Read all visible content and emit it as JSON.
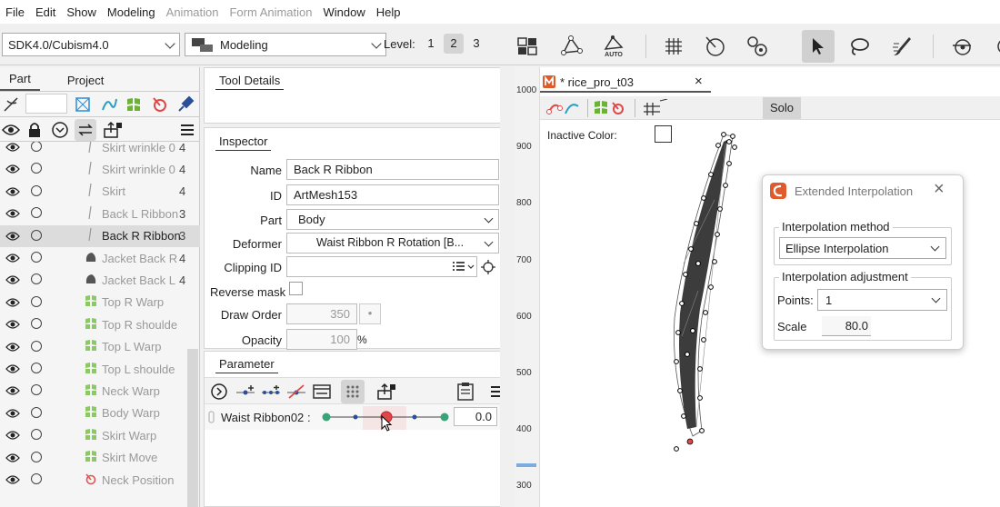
{
  "menu": [
    "File",
    "Edit",
    "Show",
    "Modeling",
    "Animation",
    "Form Animation",
    "Window",
    "Help"
  ],
  "menu_disabled": [
    false,
    false,
    false,
    false,
    true,
    true,
    false,
    false
  ],
  "toolbar": {
    "sdk_combo": "SDK4.0/Cubism4.0",
    "mode_combo": "Modeling",
    "level_label": "Level:",
    "levels": [
      "1",
      "2",
      "3"
    ],
    "auto_label": "AUTO"
  },
  "left_panel": {
    "tabs": [
      "Part",
      "Project"
    ],
    "rows": [
      {
        "label": "Skirt wrinkle 0",
        "num": "4",
        "icon": "mesh-icon"
      },
      {
        "label": "Skirt wrinkle 0",
        "num": "4",
        "icon": "mesh-icon"
      },
      {
        "label": "Skirt",
        "num": "4",
        "icon": "mesh-icon"
      },
      {
        "label": "Back L Ribbon",
        "num": "3",
        "icon": "mesh-icon"
      },
      {
        "label": "Back R Ribbon",
        "num": "3",
        "icon": "mesh-icon"
      },
      {
        "label": "Jacket Back R",
        "num": "4",
        "icon": "mesh-icon"
      },
      {
        "label": "Jacket Back L",
        "num": "4",
        "icon": "mesh-icon"
      },
      {
        "label": "Top R Warp",
        "num": "",
        "icon": "warp-icon"
      },
      {
        "label": "Top R shoulde",
        "num": "",
        "icon": "warp-icon"
      },
      {
        "label": "Top L Warp",
        "num": "",
        "icon": "warp-icon"
      },
      {
        "label": "Top L shoulde",
        "num": "",
        "icon": "warp-icon"
      },
      {
        "label": "Neck Warp",
        "num": "",
        "icon": "warp-icon"
      },
      {
        "label": "Body Warp",
        "num": "",
        "icon": "warp-icon"
      },
      {
        "label": "Skirt Warp",
        "num": "",
        "icon": "warp-icon"
      },
      {
        "label": "Skirt Move",
        "num": "",
        "icon": "warp-icon"
      },
      {
        "label": "Neck Position",
        "num": "",
        "icon": "rotation-icon"
      }
    ]
  },
  "tool_details": {
    "title": "Tool Details"
  },
  "inspector": {
    "title": "Inspector",
    "name_label": "Name",
    "name": "Back R Ribbon",
    "id_label": "ID",
    "id": "ArtMesh153",
    "part_label": "Part",
    "part": "Body",
    "deformer_label": "Deformer",
    "deformer": "Waist Ribbon R Rotation",
    "deformer_suffix": "[B...",
    "clipping_label": "Clipping ID",
    "clipping": "",
    "reverse_label": "Reverse mask",
    "draw_order_label": "Draw Order",
    "draw_order": "350",
    "opacity_label": "Opacity",
    "opacity": "100",
    "opacity_unit": "%"
  },
  "parameter": {
    "title": "Parameter",
    "name": "Waist Ribbon02",
    "value": "0.0"
  },
  "viewport": {
    "tab_title": "* rice_pro_t03",
    "solo": "Solo",
    "inactive_color_label": "Inactive Color:",
    "ruler_ticks": [
      "1000",
      "900",
      "800",
      "700",
      "600",
      "500",
      "400",
      "300"
    ]
  },
  "dialog": {
    "title": "Extended Interpolation",
    "method_group": "Interpolation method",
    "method": "Ellipse Interpolation",
    "adjust_group": "Interpolation adjustment",
    "points_label": "Points:",
    "points": "1",
    "scale_label": "Scale",
    "scale": "80.0"
  },
  "colors": {
    "accent": "#e05a2b",
    "selected_row": "#dcdcdc",
    "mesh_dark": "#3c3c3c",
    "handle_red": "#e04848",
    "slider_green": "#3aa37a"
  }
}
